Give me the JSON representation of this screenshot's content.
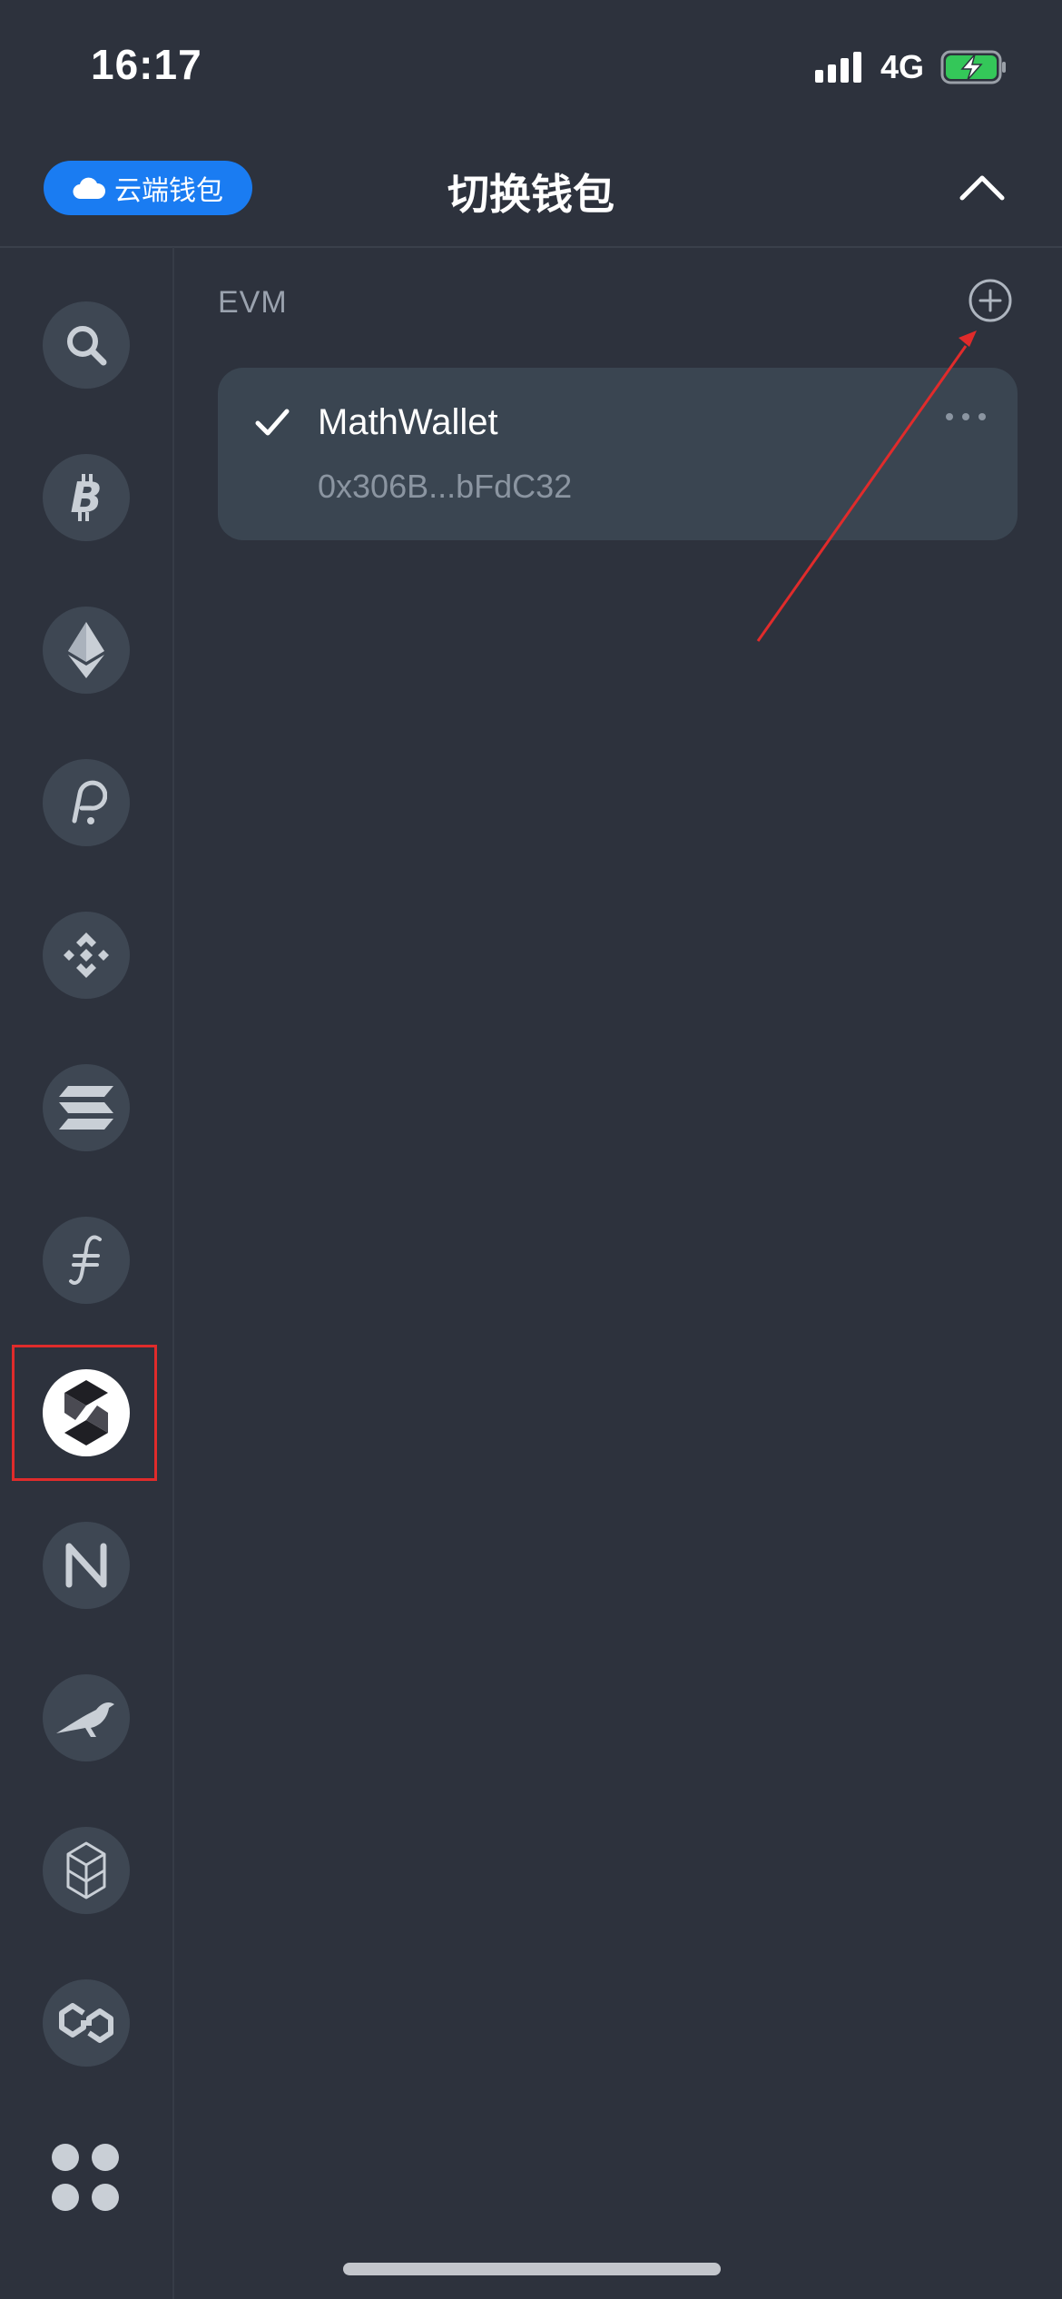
{
  "status_bar": {
    "time": "16:17",
    "network": "4G"
  },
  "header": {
    "cloud_wallet_label": "云端钱包",
    "title": "切换钱包"
  },
  "content": {
    "section_label": "EVM",
    "wallets": [
      {
        "name": "MathWallet",
        "address": "0x306B...bFdC32",
        "selected": true
      }
    ]
  },
  "sidebar": {
    "chains": [
      {
        "icon": "search-icon"
      },
      {
        "icon": "bitcoin-icon"
      },
      {
        "icon": "ethereum-icon"
      },
      {
        "icon": "polkadot-icon"
      },
      {
        "icon": "binance-icon"
      },
      {
        "icon": "solana-icon"
      },
      {
        "icon": "filecoin-icon"
      },
      {
        "icon": "evm-chain-icon",
        "selected": true
      },
      {
        "icon": "near-icon"
      },
      {
        "icon": "bird-icon"
      },
      {
        "icon": "fantom-icon"
      },
      {
        "icon": "polygon-icon"
      },
      {
        "icon": "more-apps-icon"
      }
    ]
  },
  "colors": {
    "background": "#2d323d",
    "card": "#3a4551",
    "accent": "#1a7cf2",
    "annotation": "#e02b2b",
    "battery": "#34c759"
  }
}
